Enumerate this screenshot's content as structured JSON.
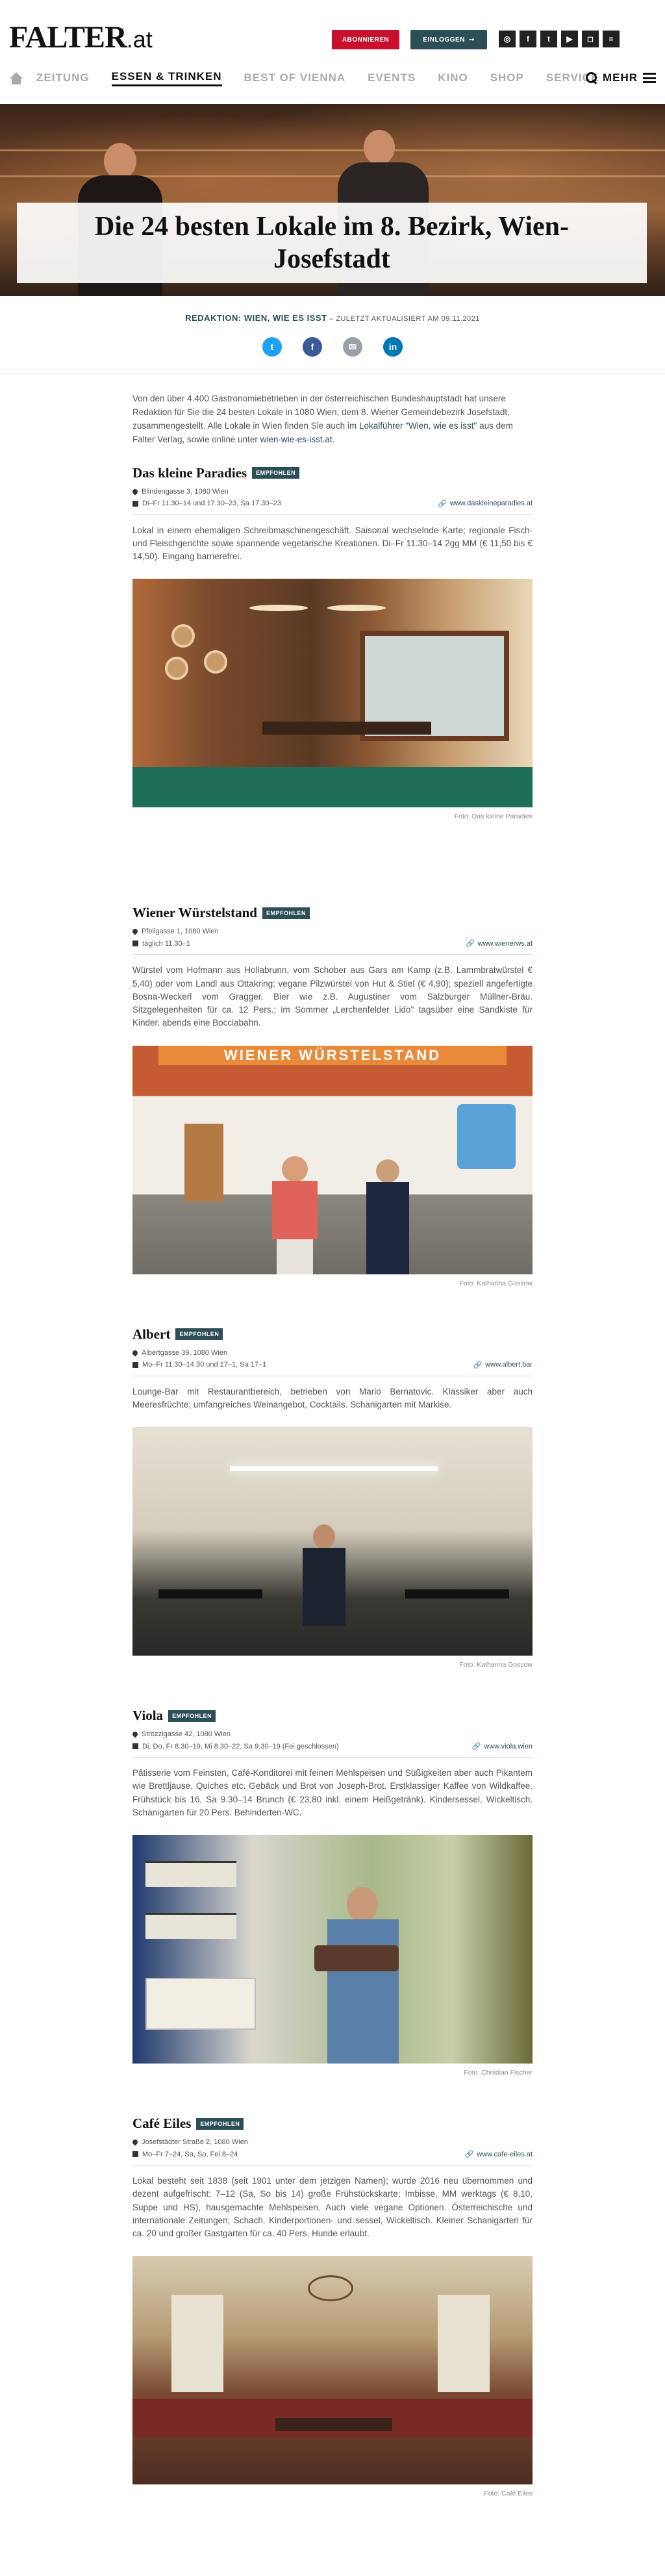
{
  "brand": {
    "logo_main": "FALTER",
    "logo_suffix": ".at"
  },
  "header": {
    "subscribe_label": "ABONNIEREN",
    "login_label": "EINLOGGEN",
    "social_icons": [
      "instagram-icon",
      "facebook-icon",
      "twitter-icon",
      "youtube-icon",
      "instagram-alt-icon",
      "rss-icon"
    ]
  },
  "nav": {
    "items": [
      {
        "label": "ZEITUNG",
        "active": false
      },
      {
        "label": "ESSEN & TRINKEN",
        "active": true
      },
      {
        "label": "BEST OF VIENNA",
        "active": false
      },
      {
        "label": "EVENTS",
        "active": false
      },
      {
        "label": "KINO",
        "active": false
      },
      {
        "label": "SHOP",
        "active": false
      },
      {
        "label": "SERVICE",
        "active": false
      }
    ],
    "more_label": "MEHR"
  },
  "article": {
    "title": "Die 24 besten Lokale im 8. Bezirk, Wien-Josefstadt",
    "byline_label": "REDAKTION: WIEN, WIE ES ISST",
    "byline_updated": " – ZULETZT AKTUALISIERT AM 09.11.2021",
    "intro_text": "Von den über 4.400 Gastronomiebetrieben in der österreichischen Bundeshauptstadt hat unsere Redaktion für Sie die 24 besten Lokale in 1080 Wien, dem 8. Wiener Gemeindebezirk Josefstadt, zusammengestellt. Alle Lokale in Wien finden Sie auch im ",
    "intro_link1": "Lokalführer \"Wien, wie es isst\"",
    "intro_mid": " aus dem Falter Verlag, sowie online unter ",
    "intro_link2": "wien-wie-es-isst.at",
    "intro_end": "."
  },
  "entries": [
    {
      "name": "Das kleine Paradies",
      "badge": "EMPFOHLEN",
      "address": "Blindengasse 3, 1080 Wien",
      "hours": "Di–Fr 11.30–14 und 17.30–23, Sa 17.30–23",
      "website": "www.daskleineparadies.at",
      "description": "Lokal in einem ehemaligen Schreibmaschinengeschäft. Saisonal wechselnde Karte; regionale Fisch- und Fleischgerichte sowie spannende vegetarische Kreationen. Di–Fr 11.30–14 2gg MM (€ 11,50 bis € 14,50). Eingang barrierefrei.",
      "caption": "Foto: Das kleine Paradies"
    },
    {
      "name": "Wiener Würstelstand",
      "badge": "EMPFOHLEN",
      "address": "Pfeilgasse 1, 1080 Wien",
      "hours": "täglich 11.30–1",
      "website": "www.wienerws.at",
      "description": "Würstel vom Hofmann aus Hollabrunn, vom Schober aus Gars am Kamp (z.B. Lammbratwürstel € 5,40) oder vom Landl aus Ottakring; vegane Pilzwürstel von Hut & Stiel (€ 4,90); speziell angefertigte Bosna-Weckerl vom Gragger. Bier wie z.B. Augustiner vom Salzburger Müllner-Bräu. Sitzgelegenheiten für ca. 12 Pers.; im Sommer „Lerchenfelder Lido\" tagsüber eine Sandkiste für Kinder, abends eine Bocciabahn.",
      "caption": "Foto: Katharina Gossow",
      "sign": "WIENER WÜRSTELSTAND"
    },
    {
      "name": "Albert",
      "badge": "EMPFOHLEN",
      "address": "Albertgasse 39, 1080 Wien",
      "hours": "Mo–Fr 11.30–14.30 und 17–1, Sa 17–1",
      "website": "www.albert.bar",
      "description": "Lounge-Bar mit Restaurantbereich, betrieben von Mario Bernatovic. Klassiker aber auch Meeresfrüchte; umfangreiches Weinangebot, Cocktails. Schanigarten mit Markise.",
      "caption": "Foto: Katharina Gossow"
    },
    {
      "name": "Viola",
      "badge": "EMPFOHLEN",
      "address": "Strozzigasse 42, 1080 Wien",
      "hours": "Di, Do, Fr 8.30–19, Mi 8.30–22, Sa 9.30–19 (Fei geschlossen)",
      "website": "www.viola.wien",
      "description": "Pâtisserie vom Feinsten, Café-Konditorei mit feinen Mehlspeisen und Süßigkeiten aber auch Pikantem wie Brettljause, Quiches etc. Gebäck und Brot von Joseph-Brot. Erstklassiger Kaffee von Wildkaffee. Frühstück bis 16, Sa 9.30–14 Brunch (€ 23,80 inkl. einem Heißgetränk). Kindersessel, Wickeltisch. Schanigarten für 20 Pers. Behinderten-WC.",
      "caption": "Foto: Christian Fischer"
    },
    {
      "name": "Café Eiles",
      "badge": "EMPFOHLEN",
      "address": "Josefstädter Straße 2, 1080 Wien",
      "hours": "Mo–Fr 7–24, Sa, So, Fei 8–24",
      "website": "www.cafe-eiles.at",
      "description": "Lokal besteht seit 1838 (seit 1901 unter dem jetzigen Namen); wurde 2016 neu übernommen und dezent aufgefrischt; 7–12 (Sa, So bis 14) große Frühstückskarte; Imbisse, MM werktags (€ 8,10, Suppe und HS), hausgemachte Mehlspeisen. Auch viele vegane Optionen. Österreichische und internationale Zeitungen; Schach. Kinderportionen- und sessel, Wickeltisch. Kleiner Schanigarten für ca. 20 und großer Gastgarten für ca. 40 Pers. Hunde erlaubt.",
      "caption": "Foto: Café Eiles"
    }
  ],
  "colors": {
    "accent_red": "#c8102e",
    "accent_teal": "#2c4f57"
  }
}
